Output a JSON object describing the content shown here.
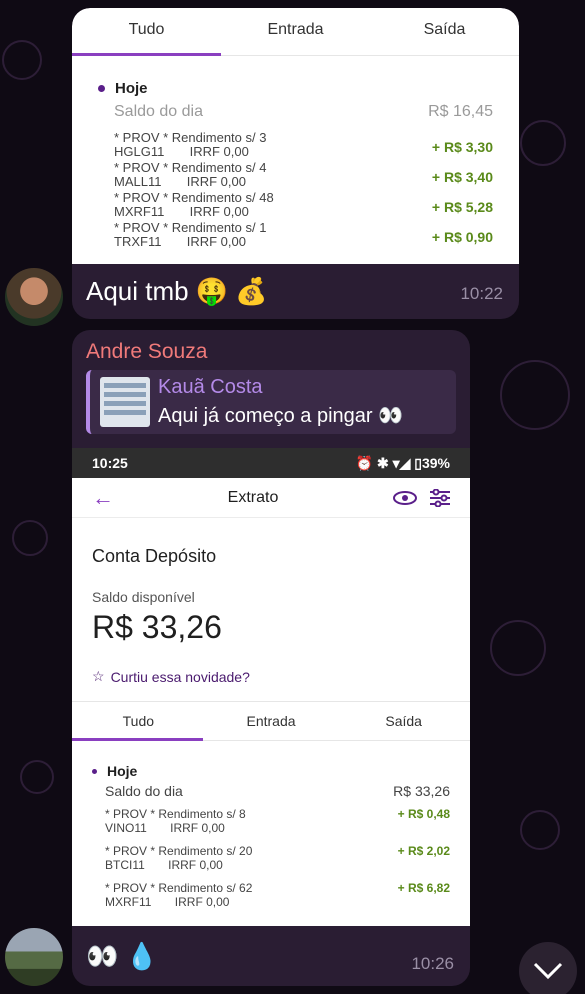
{
  "message1": {
    "tabs": [
      "Tudo",
      "Entrada",
      "Saída"
    ],
    "day_label": "Hoje",
    "saldo_label": "Saldo do dia",
    "saldo_value": "R$ 16,45",
    "transactions": [
      {
        "line1": "* PROV * Rendimento s/ 3",
        "line2": "HGLG11       IRRF 0,00",
        "amount": "+ R$ 3,30"
      },
      {
        "line1": "* PROV * Rendimento s/ 4",
        "line2": "MALL11       IRRF 0,00",
        "amount": "+ R$ 3,40"
      },
      {
        "line1": "* PROV * Rendimento s/ 48",
        "line2": "MXRF11       IRRF 0,00",
        "amount": "+ R$ 5,28"
      },
      {
        "line1": "* PROV * Rendimento s/ 1",
        "line2": "TRXF11       IRRF 0,00",
        "amount": "+ R$ 0,90"
      }
    ],
    "caption": "Aqui tmb 🤑 💰",
    "time": "10:22"
  },
  "message2": {
    "sender": "Andre Souza",
    "reply": {
      "author": "Kauã Costa",
      "text": "Aqui já começo a pingar 👀"
    },
    "status_bar": {
      "time": "10:25",
      "icons": "⏰ ✱ ▾◢ ▯39%"
    },
    "nav_title": "Extrato",
    "account_title": "Conta Depósito",
    "balance_label": "Saldo disponível",
    "balance_value": "R$ 33,26",
    "novidade": "Curtiu essa novidade?",
    "tabs": [
      "Tudo",
      "Entrada",
      "Saída"
    ],
    "day_label": "Hoje",
    "saldo_label": "Saldo do dia",
    "saldo_value": "R$ 33,26",
    "transactions": [
      {
        "line1": "* PROV * Rendimento s/ 8",
        "line2": "VINO11       IRRF 0,00",
        "amount": "+ R$ 0,48"
      },
      {
        "line1": "* PROV * Rendimento s/ 20",
        "line2": "BTCI11       IRRF 0,00",
        "amount": "+ R$ 2,02"
      },
      {
        "line1": "* PROV * Rendimento s/ 62",
        "line2": "MXRF11       IRRF 0,00",
        "amount": "+ R$ 6,82"
      }
    ],
    "caption": "👀 💧",
    "time": "10:26"
  },
  "colors": {
    "background": "#0f0a14",
    "bubble": "#2a1d33",
    "accent_purple": "#8a3fc0",
    "sender_name": "#f07a7a",
    "reply_author": "#b48ae8",
    "positive_amount": "#5a8a1a"
  }
}
